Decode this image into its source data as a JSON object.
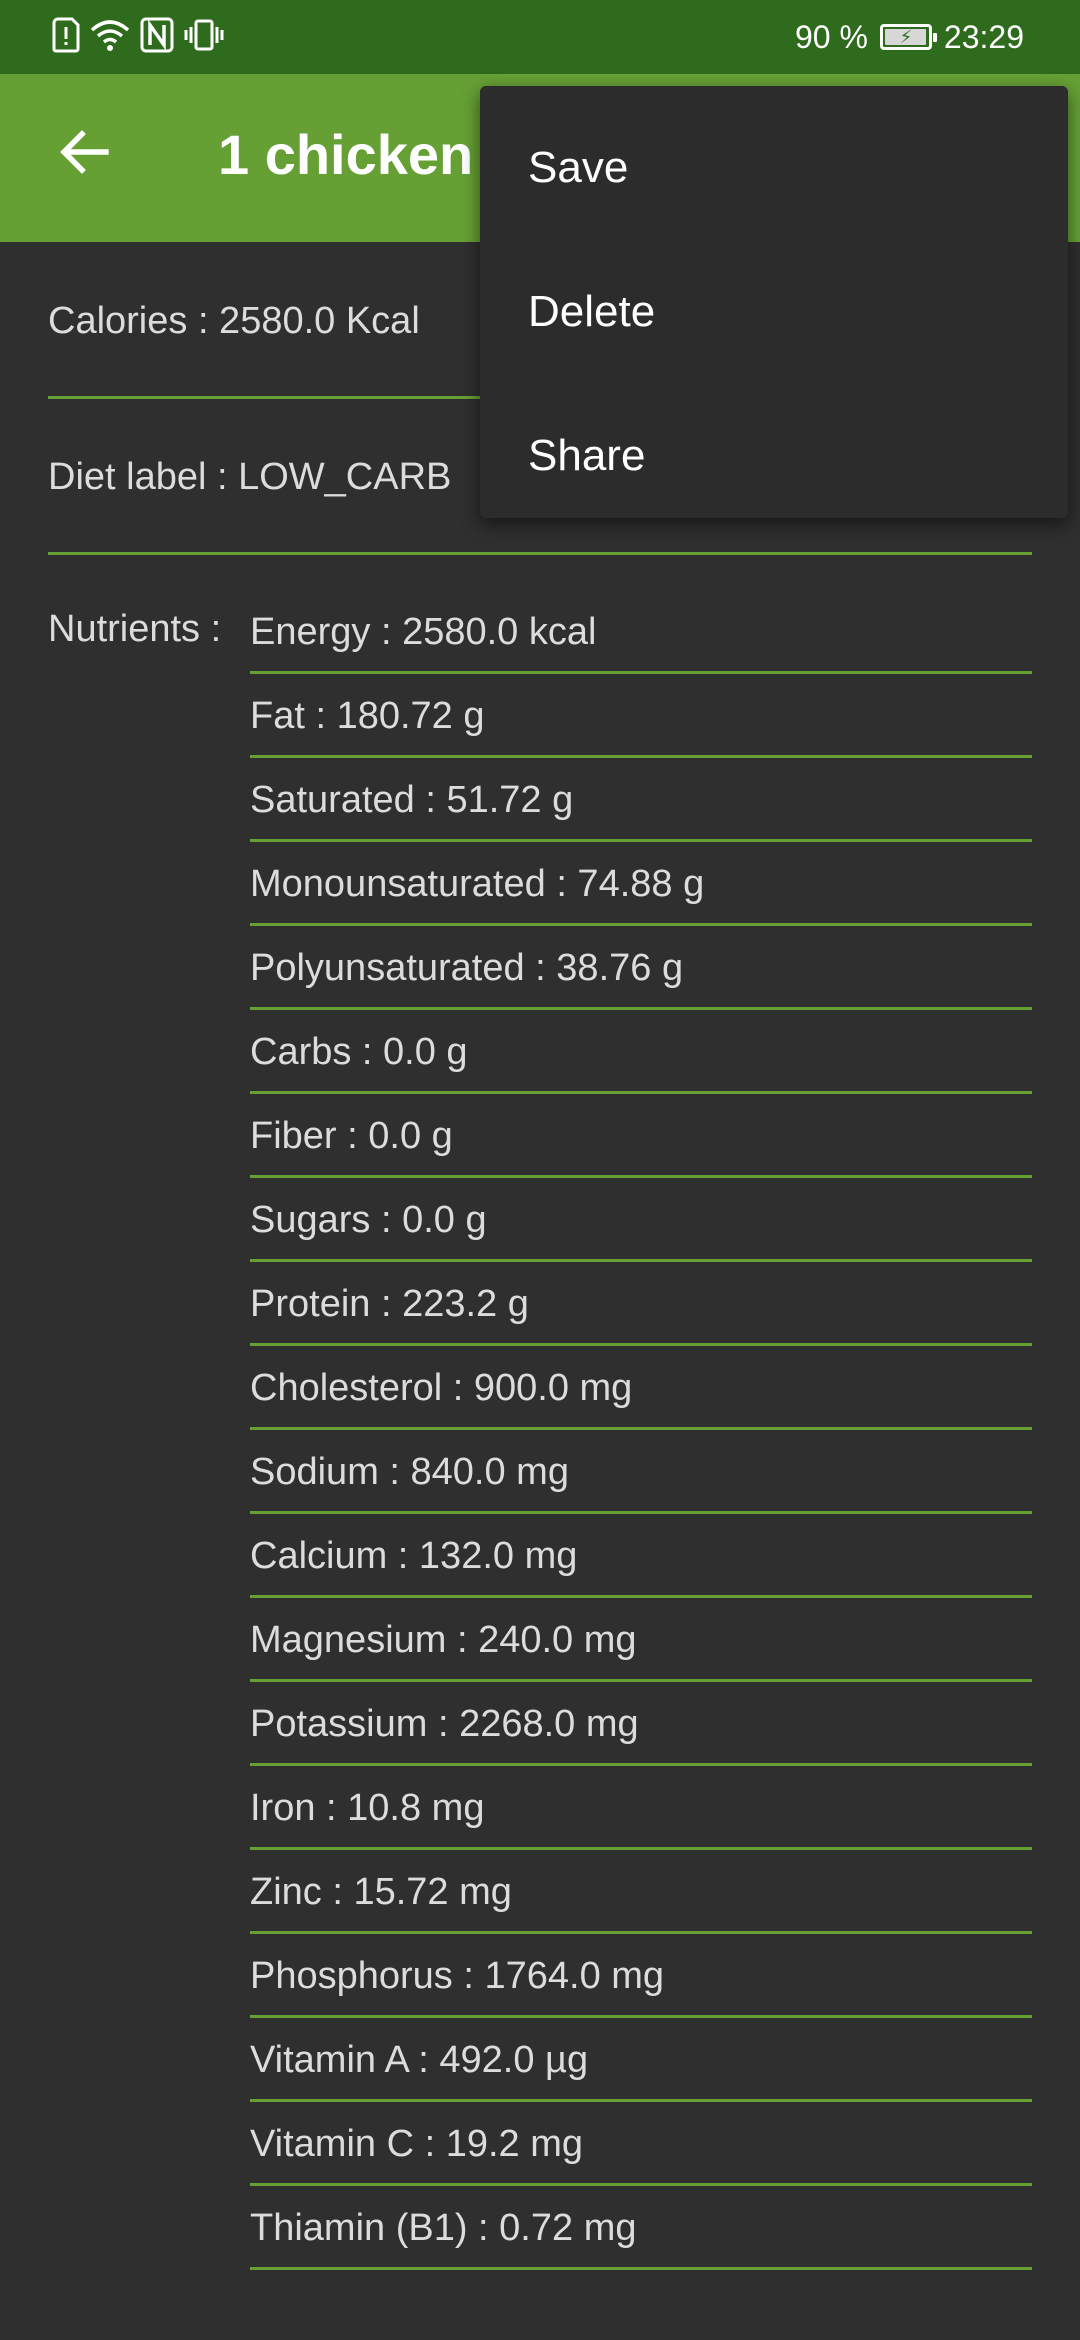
{
  "status_bar": {
    "icons": [
      "sim-alert-icon",
      "wifi-icon",
      "nfc-icon",
      "vibrate-icon"
    ],
    "battery_percent": "90 %",
    "battery_level": 0.9,
    "time": "23:29"
  },
  "app_bar": {
    "back_icon": "arrow-back-icon",
    "title": "1 chicken"
  },
  "details": {
    "calories": "Calories : 2580.0 Kcal",
    "diet_label": "Diet label : LOW_CARB",
    "nutrients_label": "Nutrients :"
  },
  "nutrients": [
    "Energy : 2580.0 kcal",
    "Fat : 180.72 g",
    "Saturated : 51.72 g",
    "Monounsaturated : 74.88 g",
    "Polyunsaturated : 38.76 g",
    "Carbs : 0.0 g",
    "Fiber : 0.0 g",
    "Sugars : 0.0 g",
    "Protein : 223.2 g",
    "Cholesterol : 900.0 mg",
    "Sodium : 840.0 mg",
    "Calcium : 132.0 mg",
    "Magnesium : 240.0 mg",
    "Potassium : 2268.0 mg",
    "Iron : 10.8 mg",
    "Zinc : 15.72 mg",
    "Phosphorus : 1764.0 mg",
    "Vitamin A : 492.0 µg",
    "Vitamin C : 19.2 mg",
    "Thiamin (B1) : 0.72 mg"
  ],
  "menu": {
    "items": [
      {
        "label": "Save"
      },
      {
        "label": "Delete"
      },
      {
        "label": "Share"
      }
    ]
  },
  "colors": {
    "status_bar": "#2f6b1c",
    "app_bar": "#66a035",
    "background": "#2f2f2f",
    "divider": "#66a035",
    "menu_background": "#2c2c2c"
  }
}
